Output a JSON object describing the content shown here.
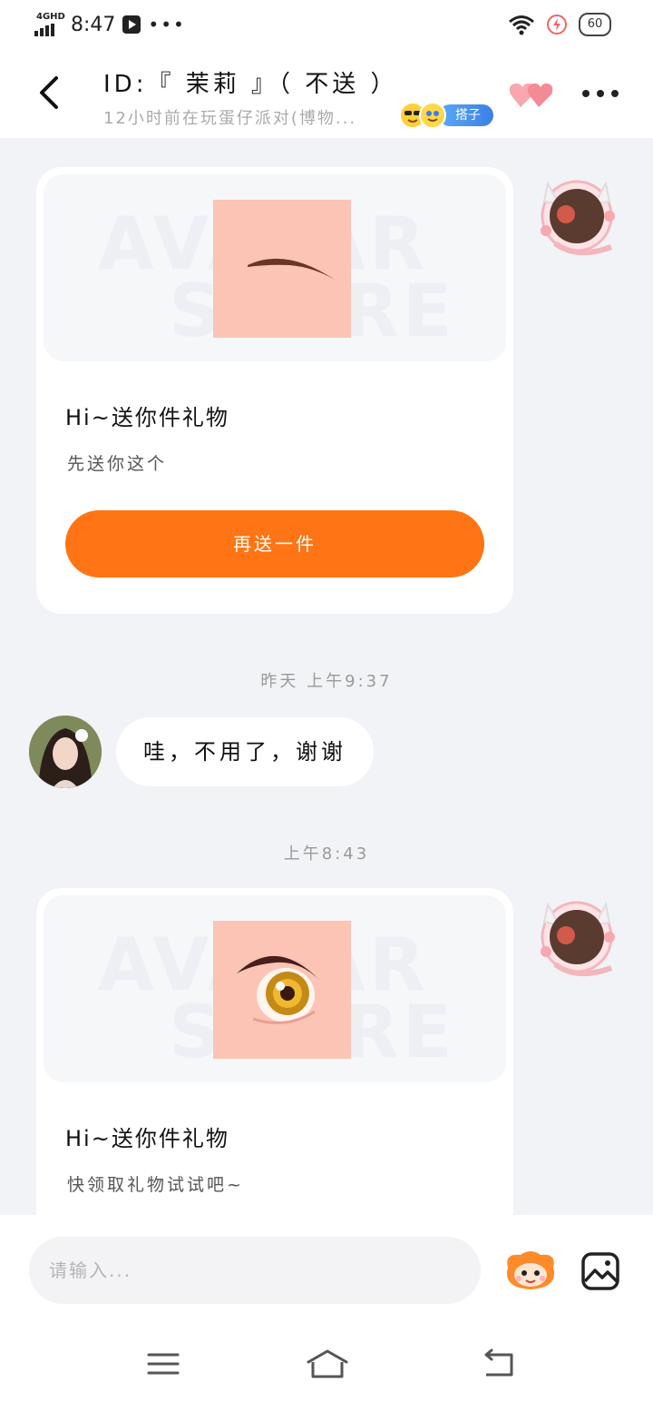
{
  "status_bar": {
    "network": "4GHD",
    "time": "8:47",
    "battery": "60"
  },
  "header": {
    "title": "ID:『 茉莉 』（ 不送 ）",
    "subtitle": "12小时前在玩蛋仔派对(博物...",
    "tag": "搭子"
  },
  "messages": {
    "card1": {
      "title": "Hi~送你件礼物",
      "desc": "先送你这个",
      "button": "再送一件",
      "watermark_top": "AVATAR",
      "watermark_bottom": "STORE"
    },
    "time1": "昨天 上午9:37",
    "reply": "哇，不用了，谢谢",
    "time2": "上午8:43",
    "card2": {
      "title": "Hi~送你件礼物",
      "desc": "快领取礼物试试吧~",
      "watermark_top": "AVATAR",
      "watermark_bottom": "STORE"
    }
  },
  "input": {
    "placeholder": "请输入..."
  },
  "colors": {
    "accent": "#ff7414",
    "background": "#f1f3f6",
    "card": "#ffffff",
    "tag": "#3b7fe6"
  },
  "icons": {
    "back": "chevron-left-icon",
    "hearts": "hearts-icon",
    "more": "more-dots-icon",
    "sticker": "sticker-mascot-icon",
    "image": "image-icon",
    "nav_menu": "menu-icon",
    "nav_home": "home-icon",
    "nav_back": "back-arrow-icon"
  }
}
